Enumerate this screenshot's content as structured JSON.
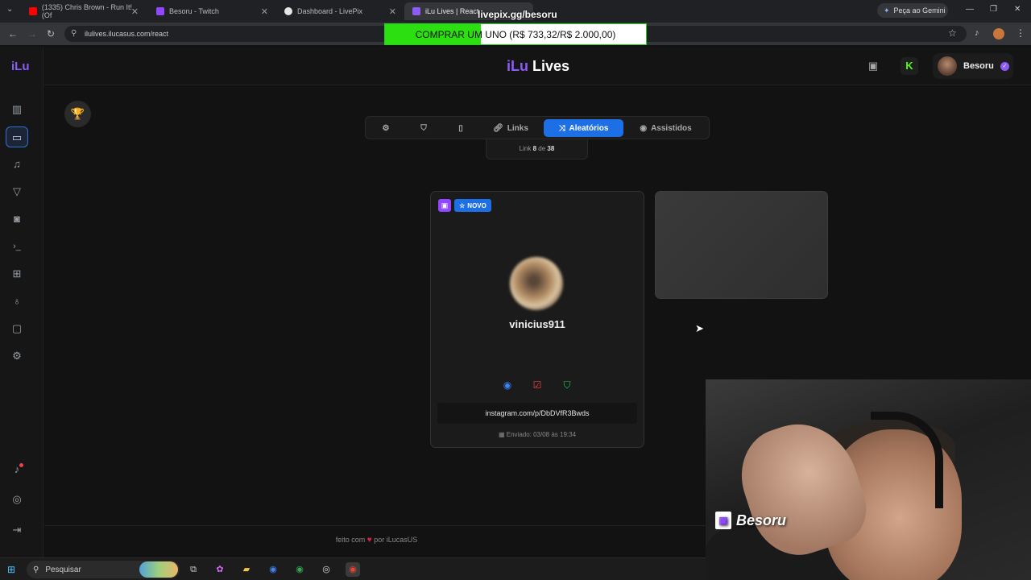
{
  "browser": {
    "tabs": [
      {
        "title": "(1335) Chris Brown - Run It! (Of",
        "favicon_color": "#ff0000"
      },
      {
        "title": "Besoru - Twitch",
        "favicon_color": "#9146ff"
      },
      {
        "title": "Dashboard - LivePix",
        "favicon_color": "#e6e6e6"
      },
      {
        "title": "iLu Lives | React",
        "favicon_color": "#8b5cf6"
      }
    ],
    "gemini_label": "Peça ao Gemini",
    "url": "ilulives.ilucasus.com/react"
  },
  "overlay": {
    "site": "livepix.gg/besoru",
    "donation_goal_text": "COMPRAR UM UNO (R$ 733,32/R$ 2.000,00)",
    "donation_progress": 0.3667,
    "accent": "#2bdf10"
  },
  "app": {
    "logo_small": "iLu",
    "brand_ilu": "iLu",
    "brand_lives": "Lives",
    "kick_label": "K",
    "user_name": "Besoru",
    "accent": "#8b5cf6"
  },
  "sidebar": {
    "items": [
      {
        "name": "stats",
        "glyph": "▥"
      },
      {
        "name": "monitor",
        "glyph": "▭"
      },
      {
        "name": "music",
        "glyph": "♫"
      },
      {
        "name": "filter",
        "glyph": "▽"
      },
      {
        "name": "camera",
        "glyph": "◙"
      },
      {
        "name": "terminal",
        "glyph": "›_"
      },
      {
        "name": "gift",
        "glyph": "⊞"
      },
      {
        "name": "award",
        "glyph": "♁"
      },
      {
        "name": "chat",
        "glyph": "▢"
      },
      {
        "name": "settings",
        "glyph": "⚙"
      }
    ],
    "bottom": [
      {
        "name": "bell",
        "glyph": "🔔"
      },
      {
        "name": "help",
        "glyph": "◎"
      },
      {
        "name": "logout",
        "glyph": "⇥"
      }
    ]
  },
  "toolbar": {
    "links_label": "Links",
    "random_label": "Aleatórios",
    "watched_label": "Assistidos",
    "counter_prefix": "Link",
    "counter_current": "8",
    "counter_sep": "de",
    "counter_total": "38"
  },
  "card": {
    "badge_new": "NOVO",
    "username": "vinicius911",
    "link": "instagram.com/p/DbDVfR3Bwds",
    "sent_at": "Enviado: 03/08 às 19:34"
  },
  "footer": {
    "made_with": "feito com",
    "by": "por iLucasUS"
  },
  "webcam": {
    "streamer_tag": "Besoru"
  },
  "taskbar": {
    "search_label": "Pesquisar"
  }
}
